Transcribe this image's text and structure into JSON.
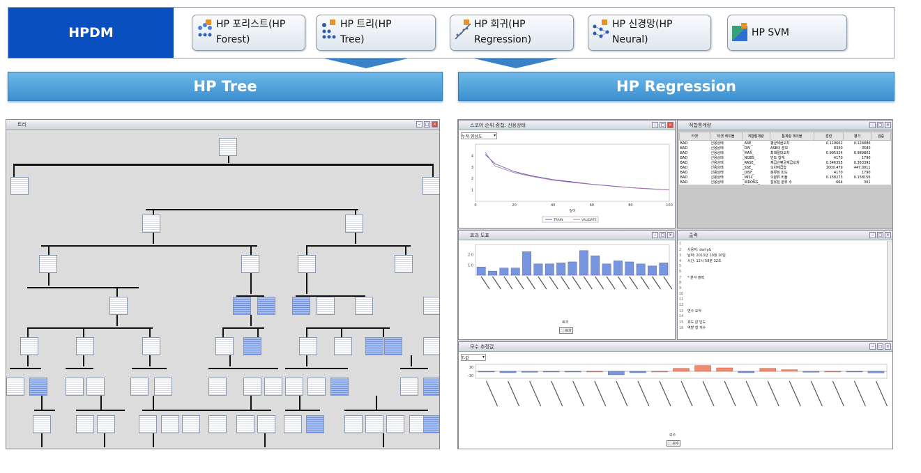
{
  "header": {
    "hpdm_label": "HPDM",
    "nodes": [
      {
        "line1": "HP 포리스트(HP",
        "line2": "Forest)",
        "icon": "forest-icon"
      },
      {
        "line1": "HP 트리(HP",
        "line2": "Tree)",
        "icon": "tree-icon"
      },
      {
        "line1": "HP 회귀(HP",
        "line2": "Regression)",
        "icon": "regression-icon"
      },
      {
        "line1": "HP 신경망(HP",
        "line2": "Neural)",
        "icon": "neural-icon"
      },
      {
        "line1": "HP SVM",
        "line2": "",
        "icon": "svm-icon"
      }
    ]
  },
  "sections": {
    "tree_title": "HP Tree",
    "regression_title": "HP Regression"
  },
  "tree_panel": {
    "title": "트리"
  },
  "regression_panels": {
    "score": {
      "title": "스코어 순위 중첩: 신용상태",
      "dropdown": "누적 향상도",
      "legend": [
        "TRAIN",
        "VALIDATE"
      ],
      "xlabel": "깊이"
    },
    "fit": {
      "title": "적합통계량",
      "columns": [
        "타겟",
        "타겟 레이블",
        "적합통계량",
        "통계량 레이블",
        "훈련",
        "평가",
        "검증"
      ],
      "rows": [
        [
          "BAD",
          "신용상태",
          "_ASE_",
          "평균제곱오차",
          "0.119662",
          "0.124886",
          ""
        ],
        [
          "BAD",
          "신용상태",
          "_DIV_",
          "ASE의 분모",
          "8340",
          "3580",
          ""
        ],
        [
          "BAD",
          "신용상태",
          "_MAX_",
          "최대절대오차",
          "0.995324",
          "0.989802",
          ""
        ],
        [
          "BAD",
          "신용상태",
          "_NOBS_",
          "빈도 합계",
          "4170",
          "1790",
          ""
        ],
        [
          "BAD",
          "신용상태",
          "_RASE_",
          "제곱근평균제곱오차",
          "0.346355",
          "0.353392",
          ""
        ],
        [
          "BAD",
          "신용상태",
          "_SSE_",
          "오차제곱합",
          "1000.479",
          "447.0911",
          ""
        ],
        [
          "BAD",
          "신용상태",
          "_DISF_",
          "분류된 빈도",
          "4170",
          "1790",
          ""
        ],
        [
          "BAD",
          "신용상태",
          "_MISC_",
          "오분류 비율",
          "0.158273",
          "0.158156",
          ""
        ],
        [
          "BAD",
          "신용상태",
          "_WRONG_",
          "잘못된 분류 수",
          "664",
          "301",
          ""
        ]
      ]
    },
    "effects": {
      "title": "효과 도표",
      "xlabel": "효과",
      "button": "⬚ 효과"
    },
    "output": {
      "title": "출력",
      "lines": [
        "",
        "사용자:             dorty&",
        "날짜:              2013년 10월 10일",
        "시간:              12시 58분 32초",
        "",
        "",
        "* 분석 출력",
        "",
        "",
        "",
        "",
        "",
        "변수 요약",
        "",
        "측도 값      빈도",
        "역할    형   개수"
      ]
    },
    "estimates": {
      "title": "모수 추정값",
      "dropdown": "T-값",
      "xlabel": "모수",
      "button": "⬚ 모수"
    }
  },
  "chart_data": [
    {
      "type": "line",
      "title": "",
      "xlabel": "깊이",
      "ylabel": "",
      "x": [
        5,
        10,
        20,
        30,
        40,
        50,
        60,
        70,
        80,
        90,
        100
      ],
      "series": [
        {
          "name": "TRAIN",
          "values": [
            4.1,
            3.3,
            2.6,
            2.2,
            1.9,
            1.7,
            1.5,
            1.35,
            1.2,
            1.1,
            1.0
          ]
        },
        {
          "name": "VALIDATE",
          "values": [
            4.3,
            3.1,
            2.5,
            2.15,
            1.85,
            1.65,
            1.48,
            1.33,
            1.19,
            1.08,
            1.0
          ]
        }
      ],
      "ylim": [
        0,
        5
      ],
      "xlim": [
        0,
        100
      ]
    },
    {
      "type": "bar",
      "title": "",
      "xlabel": "효과",
      "categories": [
        "c1",
        "c2",
        "c3",
        "c4",
        "c5",
        "c6",
        "c7",
        "c8",
        "c9",
        "c10",
        "c11",
        "c12",
        "c13",
        "c14",
        "c15",
        "c16",
        "c17"
      ],
      "values": [
        0.8,
        0.4,
        0.7,
        0.7,
        2.3,
        1.1,
        1.1,
        1.2,
        1.3,
        2.4,
        1.9,
        1.1,
        1.4,
        1.3,
        1.1,
        0.9,
        1.2
      ],
      "ylim": [
        0,
        3
      ]
    },
    {
      "type": "bar",
      "title": "",
      "xlabel": "모수",
      "categories": [
        "p1",
        "p2",
        "p3",
        "p4",
        "p5",
        "p6",
        "p7",
        "p8",
        "p9",
        "p10",
        "p11",
        "p12",
        "p13",
        "p14",
        "p15",
        "p16",
        "p17",
        "p18",
        "p19"
      ],
      "values": [
        -0.3,
        -0.6,
        -0.4,
        -0.3,
        -0.2,
        0,
        -1.5,
        -0.6,
        0,
        1.3,
        2.5,
        1.5,
        -0.6,
        1.3,
        0.7,
        -0.4,
        0,
        -0.2,
        -0.7
      ],
      "ylim": [
        -3,
        3
      ]
    }
  ]
}
